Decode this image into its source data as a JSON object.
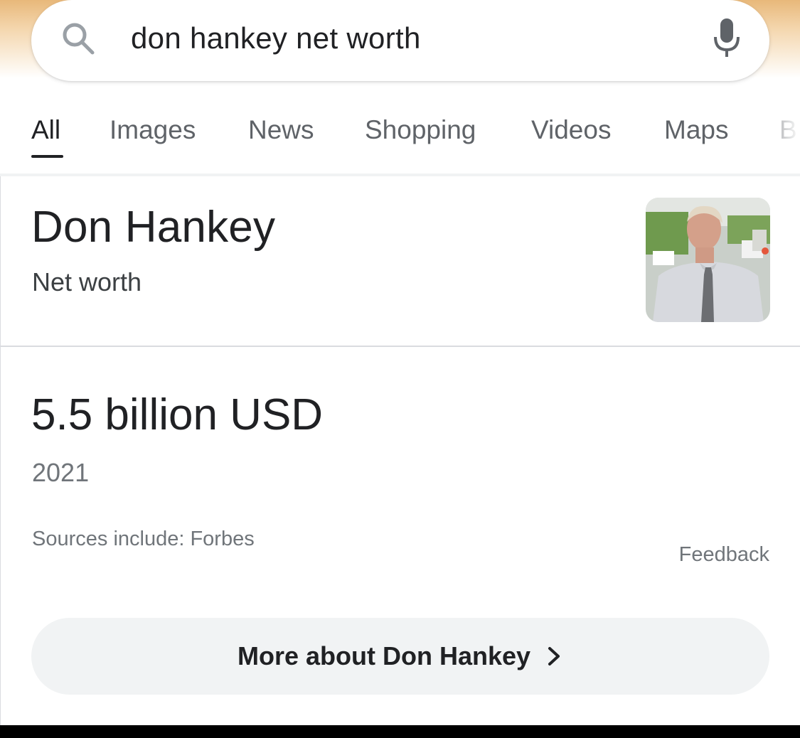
{
  "search": {
    "query": "don hankey net worth",
    "icon": "search-icon",
    "voice_icon": "mic-icon"
  },
  "tabs": [
    {
      "label": "All",
      "active": true
    },
    {
      "label": "Images",
      "active": false
    },
    {
      "label": "News",
      "active": false
    },
    {
      "label": "Shopping",
      "active": false
    },
    {
      "label": "Videos",
      "active": false
    },
    {
      "label": "Maps",
      "active": false
    },
    {
      "label": "B",
      "active": false
    }
  ],
  "entity": {
    "title": "Don Hankey",
    "subtitle": "Net worth"
  },
  "answer": {
    "value": "5.5 billion USD",
    "year": "2021",
    "sources": "Sources include: Forbes",
    "feedback": "Feedback"
  },
  "more_button": {
    "label": "More about Don Hankey",
    "icon": "chevron-right-icon"
  },
  "colors": {
    "header_accent": "#e8b87a",
    "text_primary": "#202124",
    "text_secondary": "#70757a",
    "button_bg": "#f1f3f4"
  }
}
